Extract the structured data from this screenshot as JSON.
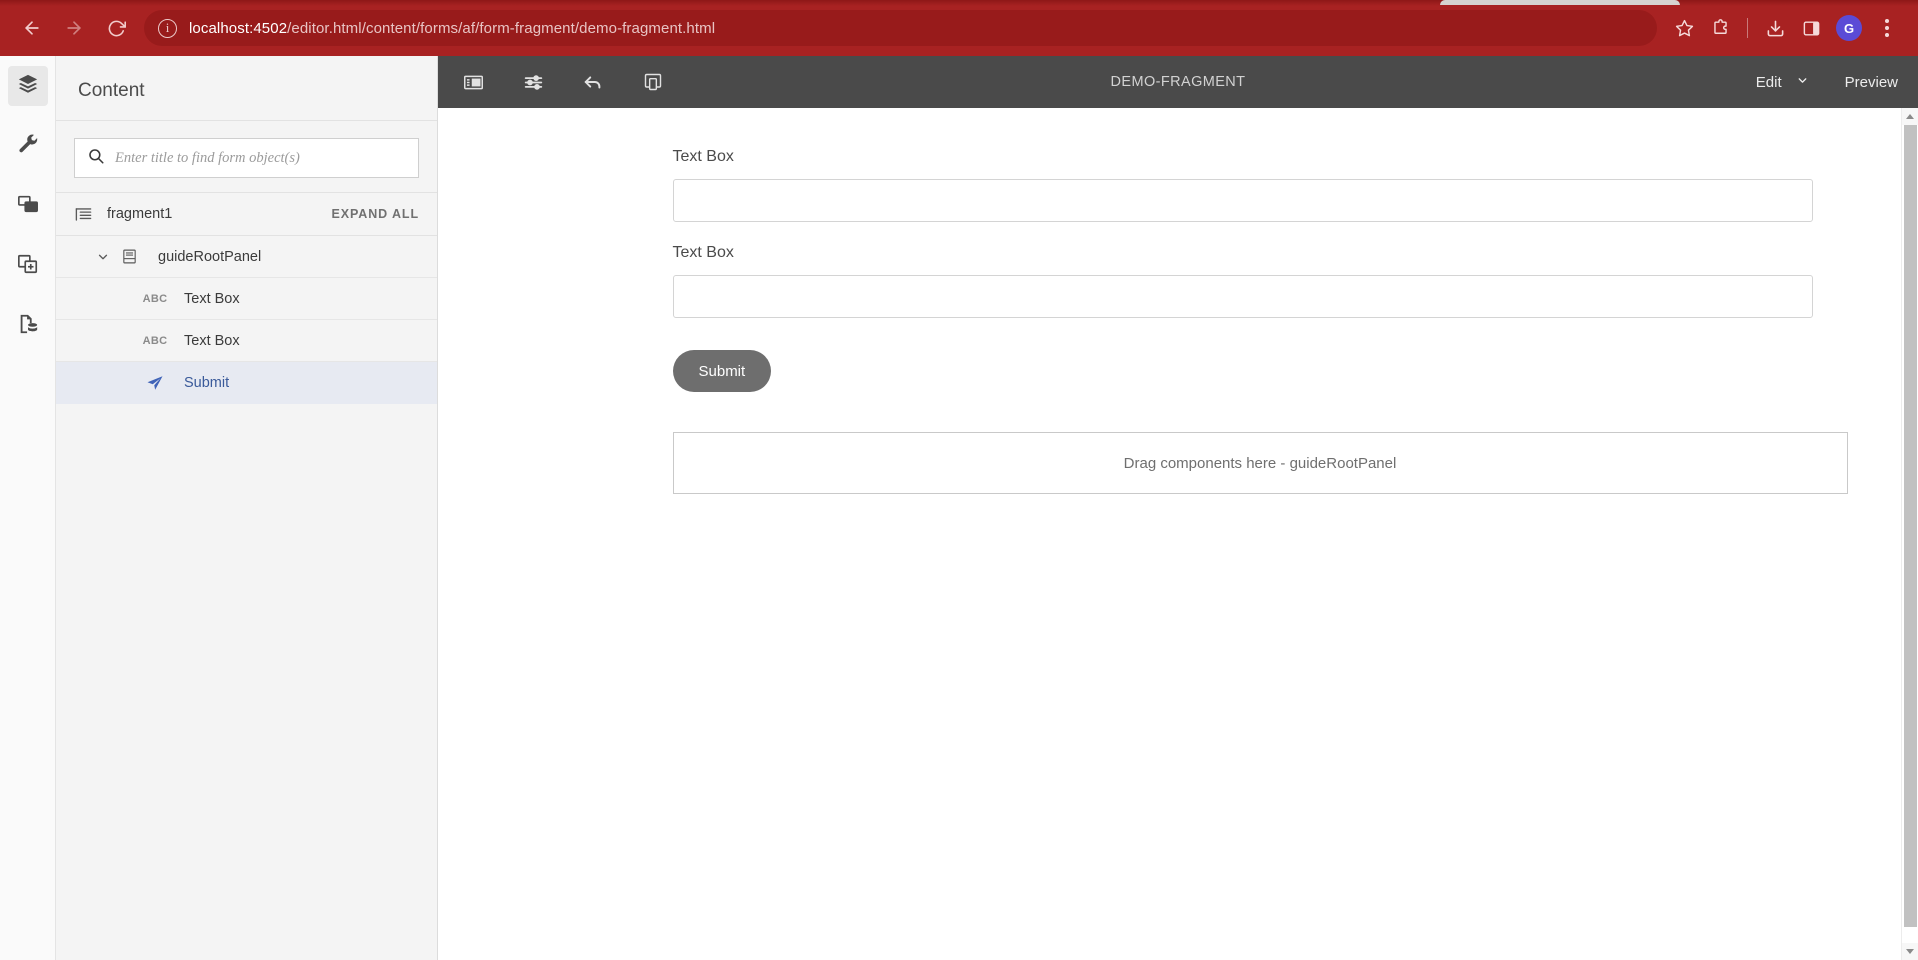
{
  "browser": {
    "url_host": "localhost:4502",
    "url_path": "/editor.html/content/forms/af/form-fragment/demo-fragment.html",
    "back_icon": "back-arrow-icon",
    "forward_icon": "forward-arrow-icon",
    "reload_icon": "reload-icon",
    "site_info_icon": "site-info-icon",
    "bookmark_icon": "star-icon",
    "extensions_icon": "extensions-puzzle-icon",
    "downloads_icon": "download-icon",
    "side_panel_icon": "side-panel-icon",
    "profile_initial": "G",
    "menu_icon": "three-dot-menu-icon",
    "theme_color": "#a82222"
  },
  "rail": {
    "items": [
      {
        "name": "content-tree",
        "icon": "layers-icon",
        "active": true
      },
      {
        "name": "components",
        "icon": "wrench-icon",
        "active": false
      },
      {
        "name": "assets",
        "icon": "assets-icon",
        "active": false
      },
      {
        "name": "components-add",
        "icon": "add-component-icon",
        "active": false
      },
      {
        "name": "content-data",
        "icon": "content-data-icon",
        "active": false
      }
    ]
  },
  "panel": {
    "title": "Content",
    "search": {
      "placeholder": "Enter title to find form object(s)",
      "value": "",
      "icon": "search-icon"
    },
    "tree_header": {
      "icon": "form-tree-icon",
      "label": "fragment1",
      "expand_all_label": "EXPAND ALL"
    },
    "tree_rows": [
      {
        "label": "guideRootPanel",
        "icon": "panel-icon",
        "chevron": "chevron-down-icon",
        "level": 1,
        "selected": false
      },
      {
        "label": "Text Box",
        "icon": "ABC",
        "level": 2,
        "selected": false
      },
      {
        "label": "Text Box",
        "icon": "ABC",
        "level": 2,
        "selected": false
      },
      {
        "label": "Submit",
        "icon": "send-icon",
        "level": 2,
        "selected": true
      }
    ]
  },
  "editor": {
    "toolbar": {
      "tools": [
        {
          "name": "toggle-side-panel",
          "icon": "side-panel-toggle-icon"
        },
        {
          "name": "page-information",
          "icon": "sliders-icon"
        },
        {
          "name": "undo",
          "icon": "undo-arrow-icon"
        },
        {
          "name": "emulator",
          "icon": "device-emulator-icon"
        }
      ],
      "title": "DEMO-FRAGMENT",
      "mode_label": "Edit",
      "mode_chevron": "chevron-down-icon",
      "preview_label": "Preview"
    },
    "form": {
      "fields": [
        {
          "label": "Text Box",
          "value": "",
          "type": "text"
        },
        {
          "label": "Text Box",
          "value": "",
          "type": "text"
        }
      ],
      "submit_label": "Submit",
      "dropzone_label": "Drag components here - guideRootPanel"
    },
    "scrollbar": {
      "up_icon": "scroll-up-arrow-icon",
      "down_icon": "scroll-down-arrow-icon"
    }
  }
}
